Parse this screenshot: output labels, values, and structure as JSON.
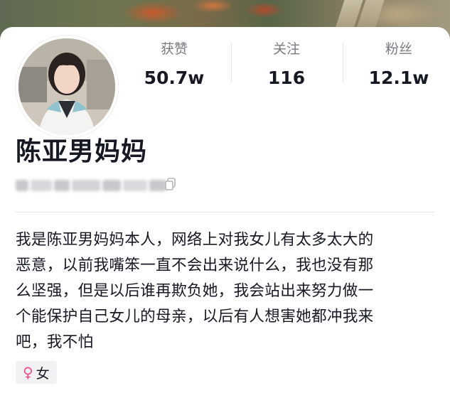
{
  "profile": {
    "name": "陈亚男妈妈",
    "avatar_icon": "user-avatar-photo",
    "id_text_blurred": true
  },
  "stats": [
    {
      "label": "获赞",
      "value": "50.7w"
    },
    {
      "label": "关注",
      "value": "116"
    },
    {
      "label": "粉丝",
      "value": "12.1w"
    }
  ],
  "bio": "我是陈亚男妈妈本人，网络上对我女儿有太多太大的\n恶意，以前我嘴笨一直不会出来说什么，我也没有那\n么坚强，但是以后谁再欺负她，我会站出来努力做一\n个能保护自己女儿的母亲，以后有人想害她都冲我来\n吧，我不怕",
  "gender_tag": {
    "symbol": "♀",
    "label": "女",
    "color": "#f0508a"
  },
  "colors": {
    "text_primary": "#161823",
    "text_secondary": "#7a7a80",
    "accent_female": "#f0508a"
  }
}
